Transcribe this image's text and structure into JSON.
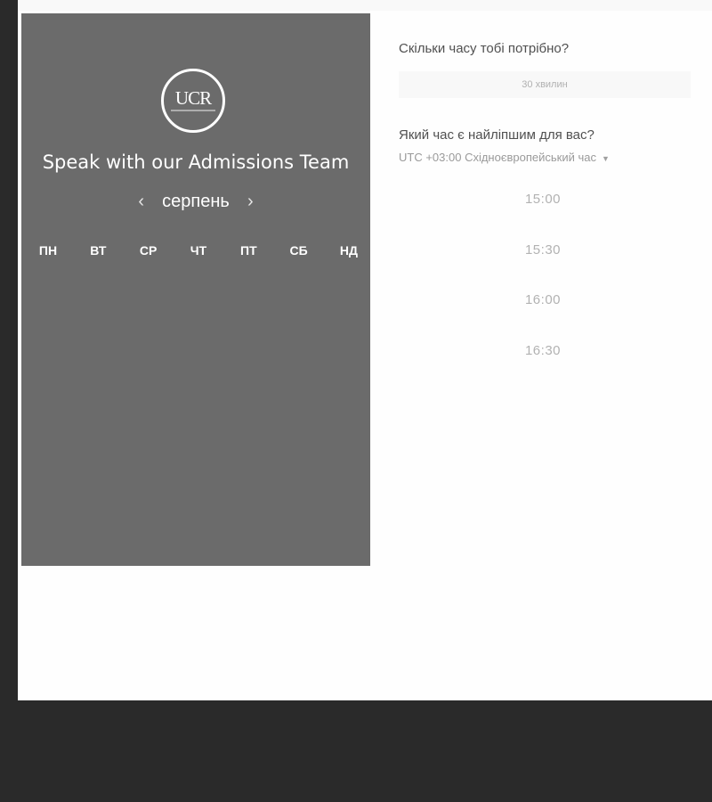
{
  "left_panel": {
    "logo_text": "UCR",
    "title": "Speak with our Admissions Team",
    "month": "серпень",
    "prev_arrow": "‹",
    "next_arrow": "›",
    "weekdays": [
      "ПН",
      "ВТ",
      "СР",
      "ЧТ",
      "ПТ",
      "СБ",
      "НД"
    ]
  },
  "right_panel": {
    "duration_question": "Скільки часу тобі потрібно?",
    "duration_value": "30 хвилин",
    "time_question": "Який час є найліпшим для вас?",
    "timezone": "UTC +03:00 Східноєвропейський час",
    "time_slots": [
      "15:00",
      "15:30",
      "16:00",
      "16:30"
    ]
  },
  "colors": {
    "panel_bg": "#6b6b6b",
    "page_bg": "#fefefe",
    "outer_bg": "#2a2a2a"
  }
}
